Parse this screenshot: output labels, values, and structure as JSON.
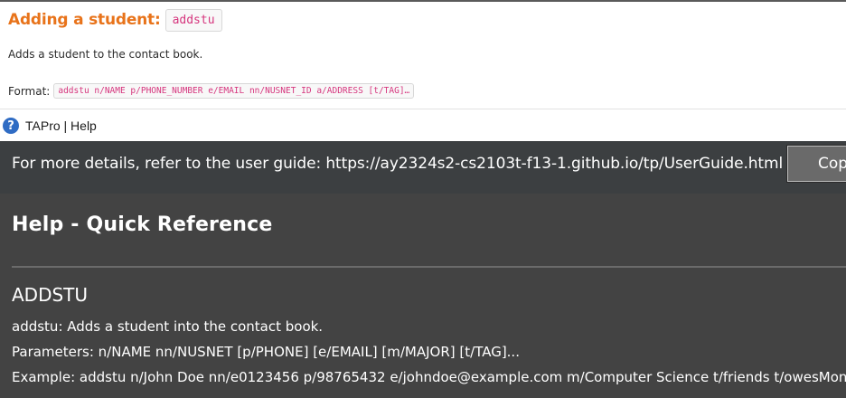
{
  "doc": {
    "heading": "Adding a student:",
    "heading_code": "addstu",
    "description": "Adds a student to the contact book.",
    "format_label": "Format:",
    "format_code": "addstu n/NAME p/PHONE_NUMBER e/EMAIL nn/NUSNET_ID a/ADDRESS [t/TAG]…"
  },
  "window": {
    "icon": "?",
    "title": "TAPro | Help"
  },
  "linkbar": {
    "text": "For more details, refer to the user guide: https://ay2324s2-cs2103t-f13-1.github.io/tp/UserGuide.html",
    "copy_label": "Copy URL"
  },
  "help": {
    "title": "Help - Quick Reference",
    "command": {
      "name": "ADDSTU",
      "usage": "addstu: Adds a student into the contact book.",
      "parameters": "Parameters: n/NAME nn/NUSNET [p/PHONE] [e/EMAIL] [m/MAJOR] [t/TAG]...",
      "example": "Example: addstu n/John Doe nn/e0123456 p/98765432 e/johndoe@example.com m/Computer Science t/friends t/owesMoney"
    }
  },
  "colors": {
    "doc_heading": "#e8731a",
    "code_text": "#d6367e",
    "linkbar_bg": "#3c3f41",
    "panel_bg": "#434343",
    "app_icon": "#2f6cc4"
  }
}
